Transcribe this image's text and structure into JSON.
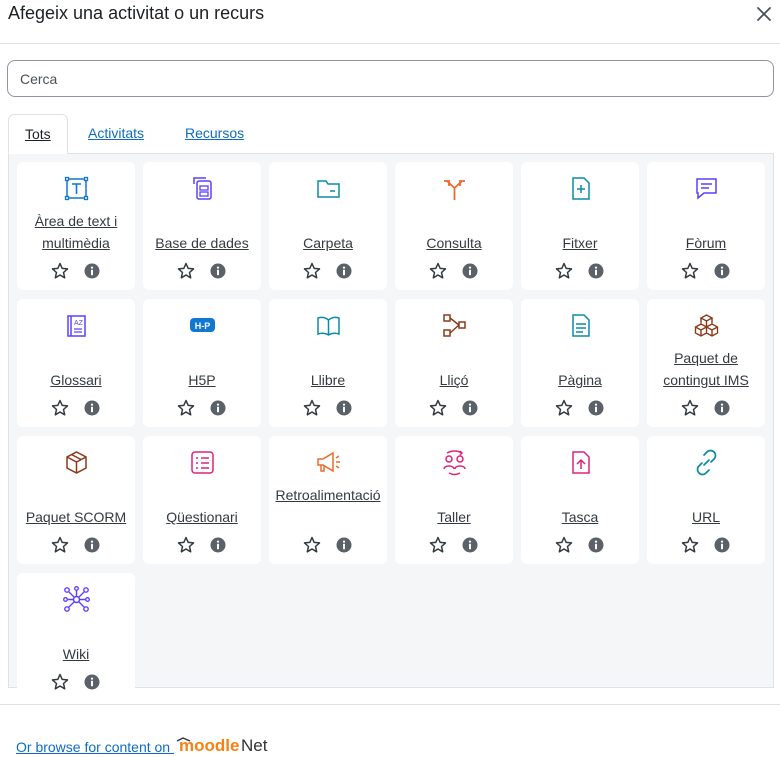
{
  "dialog": {
    "title": "Afegeix una activitat o un recurs",
    "search_placeholder": "Cerca"
  },
  "tabs": [
    {
      "label": "Tots",
      "active": true
    },
    {
      "label": "Activitats",
      "active": false
    },
    {
      "label": "Recursos",
      "active": false
    }
  ],
  "items": [
    {
      "label": "Àrea de text i multimèdia",
      "icon": "text-area-icon",
      "color": "#1177d1"
    },
    {
      "label": "Base de dades",
      "icon": "database-icon",
      "color": "#5b40ff"
    },
    {
      "label": "Carpeta",
      "icon": "folder-icon",
      "color": "#0d8ba3"
    },
    {
      "label": "Consulta",
      "icon": "choice-icon",
      "color": "#eb6a2d"
    },
    {
      "label": "Fitxer",
      "icon": "file-icon",
      "color": "#0d8ba3"
    },
    {
      "label": "Fòrum",
      "icon": "forum-icon",
      "color": "#5b40ff"
    },
    {
      "label": "Glossari",
      "icon": "glossary-icon",
      "color": "#5b40ff"
    },
    {
      "label": "H5P",
      "icon": "h5p-icon",
      "color": "#1177d1"
    },
    {
      "label": "Llibre",
      "icon": "book-icon",
      "color": "#0d8ba3"
    },
    {
      "label": "Lliçó",
      "icon": "lesson-icon",
      "color": "#8a3b1a"
    },
    {
      "label": "Pàgina",
      "icon": "page-icon",
      "color": "#0d8ba3"
    },
    {
      "label": "Paquet de contingut IMS",
      "icon": "ims-package-icon",
      "color": "#8a3b1a"
    },
    {
      "label": "Paquet SCORM",
      "icon": "scorm-package-icon",
      "color": "#8a3b1a"
    },
    {
      "label": "Qüestionari",
      "icon": "quiz-icon",
      "color": "#e0217b"
    },
    {
      "label": "Retroalimentació",
      "icon": "feedback-icon",
      "color": "#eb6a2d"
    },
    {
      "label": "Taller",
      "icon": "workshop-icon",
      "color": "#e0217b"
    },
    {
      "label": "Tasca",
      "icon": "assignment-icon",
      "color": "#e0217b"
    },
    {
      "label": "URL",
      "icon": "url-icon",
      "color": "#0d8ba3"
    },
    {
      "label": "Wiki",
      "icon": "wiki-icon",
      "color": "#5b40ff"
    }
  ],
  "footer": {
    "browse_text": "Or browse for content on",
    "logo_moodle": "moodle",
    "logo_net": "Net"
  }
}
